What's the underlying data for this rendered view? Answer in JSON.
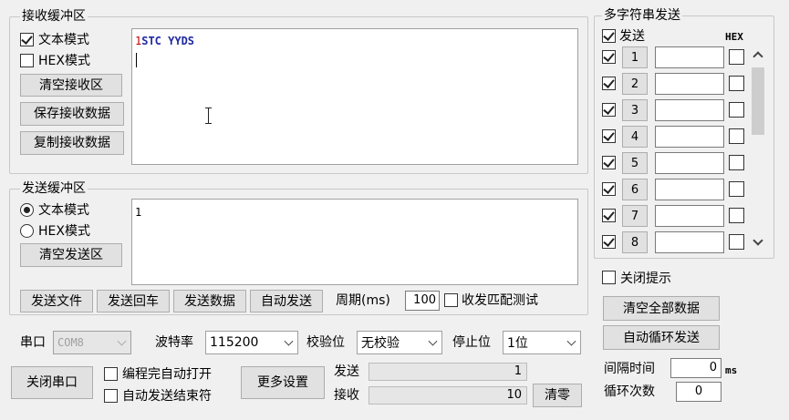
{
  "receive": {
    "group_title": "接收缓冲区",
    "text_mode_label": "文本模式",
    "hex_mode_label": "HEX模式",
    "clear_label": "清空接收区",
    "save_label": "保存接收数据",
    "copy_label": "复制接收数据",
    "content_prefix": "1",
    "content_text": "STC YYDS",
    "text_mode_checked": true,
    "hex_mode_checked": false
  },
  "send": {
    "group_title": "发送缓冲区",
    "text_mode_label": "文本模式",
    "hex_mode_label": "HEX模式",
    "clear_label": "清空发送区",
    "content": "1",
    "buttons": {
      "send_file": "发送文件",
      "send_enter": "发送回车",
      "send_data": "发送数据",
      "auto_send": "自动发送"
    },
    "period_label": "周期(ms)",
    "period_value": "100",
    "match_test_label": "收发匹配测试"
  },
  "serial": {
    "port_label": "串口",
    "port_value": "COM8",
    "baud_label": "波特率",
    "baud_value": "115200",
    "parity_label": "校验位",
    "parity_value": "无校验",
    "stop_label": "停止位",
    "stop_value": "1位",
    "close_port_label": "关闭串口",
    "auto_open_label": "编程完自动打开",
    "auto_send_end_label": "自动发送结束符",
    "more_settings_label": "更多设置",
    "sent_label": "发送",
    "sent_count": "1",
    "recv_label": "接收",
    "recv_count": "10",
    "clear_count_label": "清零"
  },
  "multi": {
    "group_title": "多字符串发送",
    "send_header": "发送",
    "hex_header": "HEX",
    "rows": [
      {
        "label": "1"
      },
      {
        "label": "2"
      },
      {
        "label": "3"
      },
      {
        "label": "4"
      },
      {
        "label": "5"
      },
      {
        "label": "6"
      },
      {
        "label": "7"
      },
      {
        "label": "8"
      }
    ],
    "close_tips_label": "关闭提示",
    "clear_all_label": "清空全部数据",
    "auto_loop_label": "自动循环发送",
    "interval_label": "间隔时间",
    "interval_value": "0",
    "interval_unit": "ms",
    "loop_count_label": "循环次数",
    "loop_count_value": "0"
  }
}
